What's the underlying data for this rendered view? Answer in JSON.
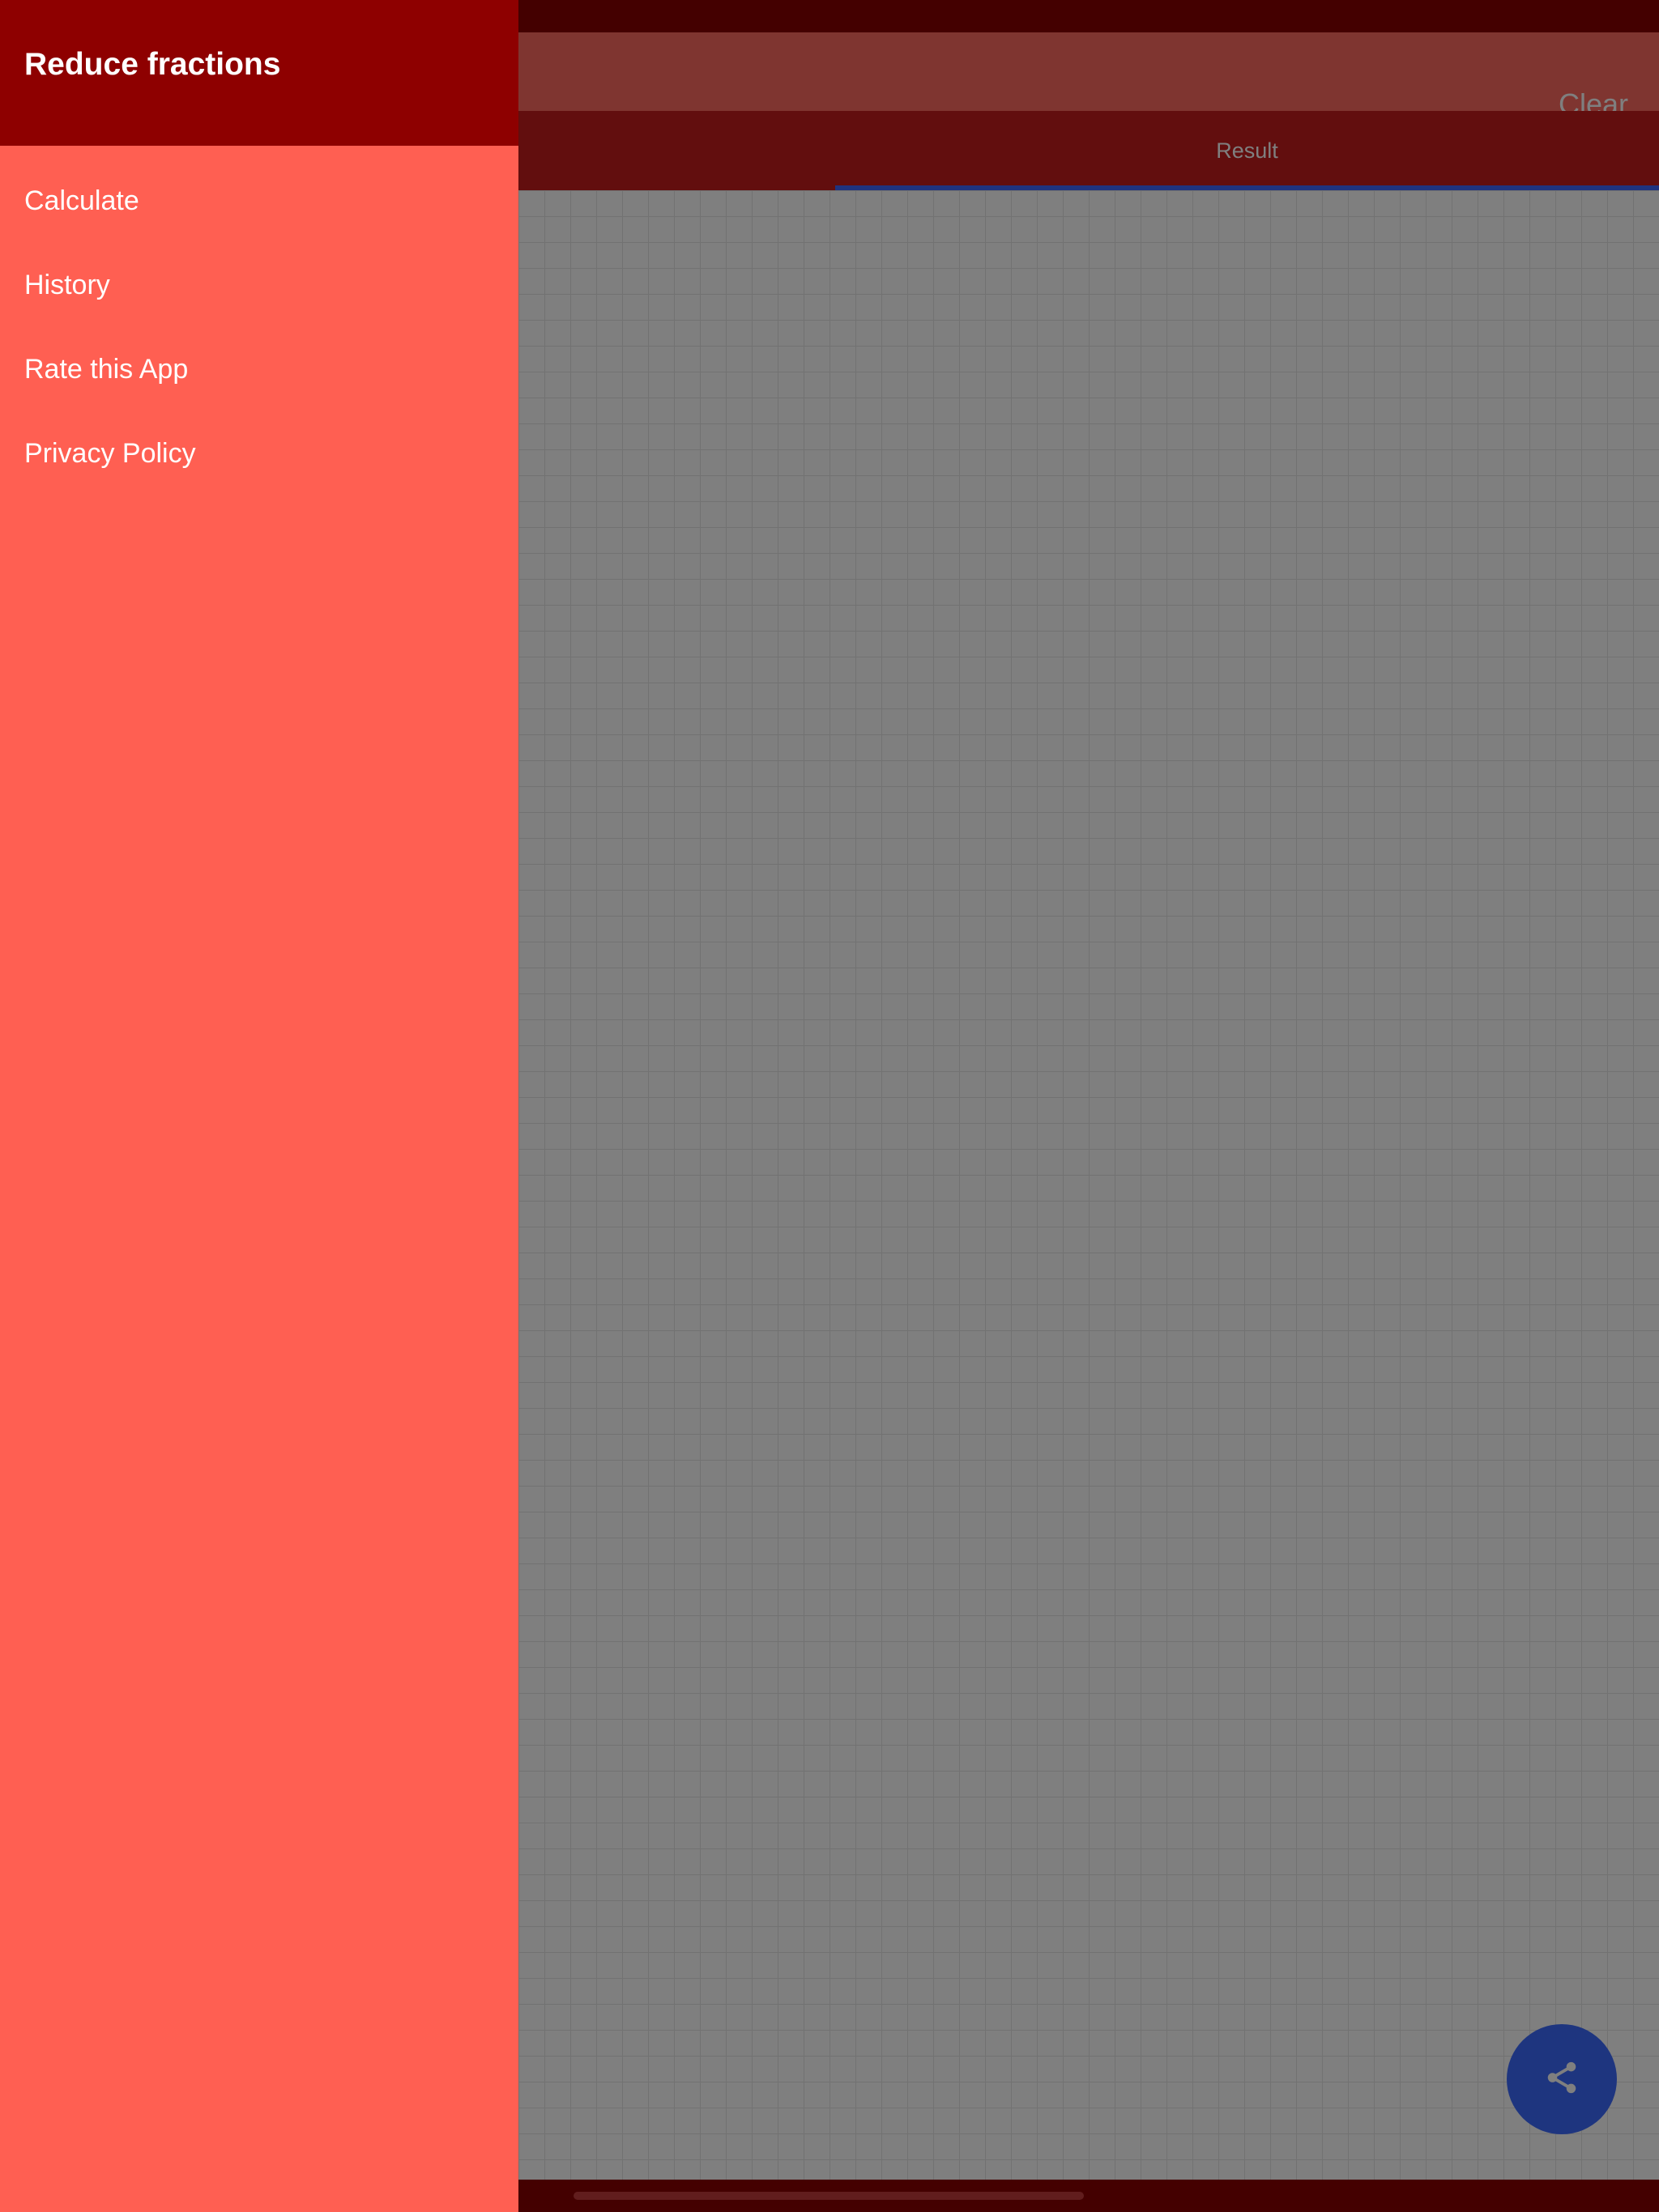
{
  "app": {
    "title": "Reduce fractions"
  },
  "toolbar": {
    "clear_label": "Clear"
  },
  "tabs": [
    {
      "label": "",
      "selected": false
    },
    {
      "label": "Result",
      "selected": true
    }
  ],
  "drawer": {
    "title": "Reduce fractions",
    "items": [
      {
        "label": "Calculate"
      },
      {
        "label": "History"
      },
      {
        "label": "Rate this App"
      },
      {
        "label": "Privacy Policy"
      }
    ]
  },
  "fab": {
    "icon": "share-icon"
  },
  "colors": {
    "primary_dark": "#8e0000",
    "drawer_background": "#ff5f52",
    "accent": "#3d6bff"
  }
}
